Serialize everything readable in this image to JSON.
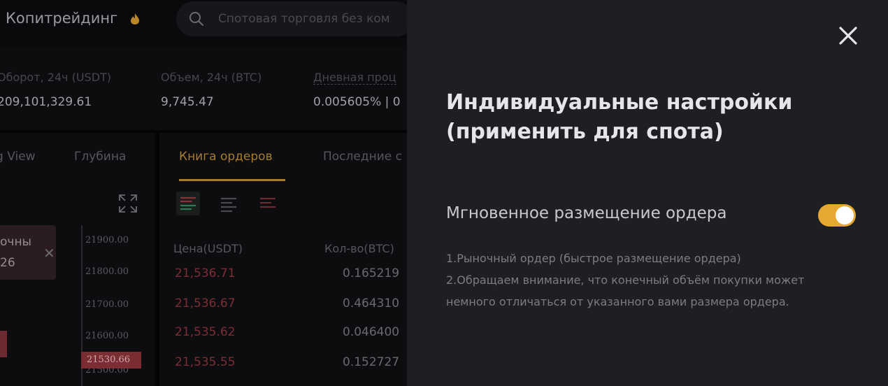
{
  "header": {
    "brand": "Копитрейдинг",
    "search_placeholder": "Спотовая торговля без ком"
  },
  "stats": [
    {
      "label": "Оборот, 24ч (USDT)",
      "value": "209,101,329.61"
    },
    {
      "label": "Объем, 24ч (BTC)",
      "value": "9,745.47"
    },
    {
      "label": "Дневная проц",
      "value": "0.005605% | 0"
    }
  ],
  "chart_tabs": {
    "tradingview": "g View",
    "depth": "Глубина"
  },
  "orderbook_tabs": {
    "book": "Книга ордеров",
    "recent": "Последние с"
  },
  "popup": {
    "line1": "очны",
    "line2": "26"
  },
  "price_axis": {
    "ticks": [
      "21900.00",
      "21800.00",
      "21700.00",
      "21600.00",
      "21500.00"
    ],
    "current": "21530.66"
  },
  "orderbook": {
    "price_header": "Цена(USDT)",
    "qty_header": "Кол-во(BTC)",
    "rows": [
      {
        "price": "21,536.71",
        "qty": "0.165219"
      },
      {
        "price": "21,536.67",
        "qty": "0.464310"
      },
      {
        "price": "21,535.62",
        "qty": "0.046400"
      },
      {
        "price": "21,535.55",
        "qty": "0.152727"
      }
    ]
  },
  "drawer": {
    "title": "Индивидуальные настройки (применить для спота)",
    "setting_label": "Мгновенное размещение ордера",
    "toggle_on": true,
    "desc_line1": "1.Рыночный ордер (быстрое размещение ордера)",
    "desc_line2": "2.Обращаем внимание, что конечный объём покупки может немного отличаться от указанного вами размера ордера."
  },
  "colors": {
    "accent": "#e8a933",
    "drawer_bg": "#1e1f23",
    "sell_red": "#7a2e34"
  }
}
